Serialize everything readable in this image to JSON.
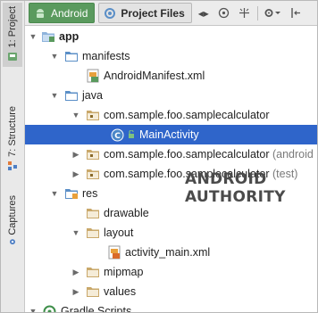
{
  "side_tabs": [
    {
      "label": "1: Project",
      "icon": "android-project-icon"
    },
    {
      "label": "7: Structure",
      "icon": "structure-icon"
    },
    {
      "label": "Captures",
      "icon": "captures-icon"
    }
  ],
  "toolbar": {
    "tab_android": "Android",
    "tab_project_files": "Project Files",
    "icons": [
      "scroll-arrows-icon",
      "target-icon",
      "collapse-icon",
      "gear-dropdown-icon",
      "hide-icon"
    ]
  },
  "tree": {
    "app": "app",
    "manifests": "manifests",
    "android_manifest": "AndroidManifest.xml",
    "java": "java",
    "pkg_main": "com.sample.foo.samplecalculator",
    "main_activity": "MainActivity",
    "pkg_android_test": "com.sample.foo.samplecalculator",
    "pkg_android_test_suffix": "(android",
    "pkg_test": "com.sample.foo.samplecalculator",
    "pkg_test_suffix": "(test)",
    "res": "res",
    "drawable": "drawable",
    "layout": "layout",
    "activity_main": "activity_main.xml",
    "mipmap": "mipmap",
    "values": "values",
    "gradle_scripts": "Gradle Scripts"
  },
  "watermark": "ANDROID AUTHORITY",
  "colors": {
    "selection": "#2f65ca",
    "folder": "#5b8fc7",
    "android_green": "#5a9a5e"
  }
}
